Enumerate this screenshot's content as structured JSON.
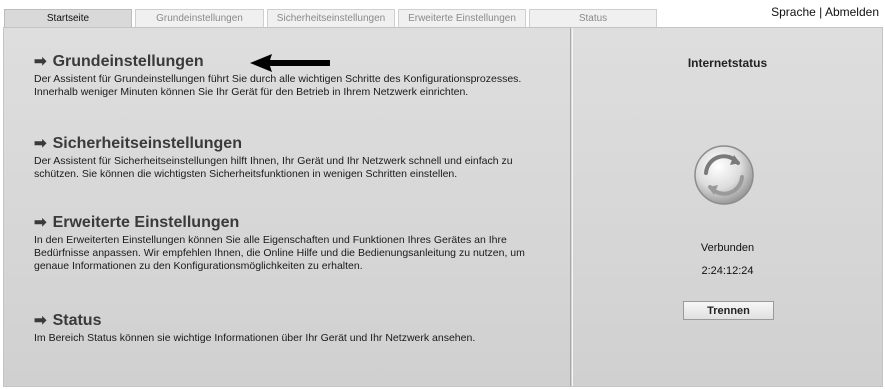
{
  "tabs": [
    {
      "label": "Startseite",
      "active": true
    },
    {
      "label": "Grundeinstellungen",
      "active": false
    },
    {
      "label": "Sicherheitseinstellungen",
      "active": false
    },
    {
      "label": "Erweiterte Einstellungen",
      "active": false
    },
    {
      "label": "Status",
      "active": false
    }
  ],
  "top_links": {
    "language": "Sprache",
    "separator": " | ",
    "logout": "Abmelden"
  },
  "sections": [
    {
      "title": "Grundeinstellungen",
      "description": "Der Assistent für Grundeinstellungen führt Sie durch alle wichtigen Schritte des Konfigurationsprozesses. Innerhalb weniger Minuten können Sie Ihr Gerät für den Betrieb in Ihrem Netzwerk einrichten."
    },
    {
      "title": "Sicherheitseinstellungen",
      "description": "Der Assistent für Sicherheitseinstellungen hilft Ihnen, Ihr Gerät und Ihr Netzwerk schnell und einfach zu schützen. Sie können die wichtigsten Sicherheitsfunktionen in wenigen Schritten einstellen."
    },
    {
      "title": "Erweiterte Einstellungen",
      "description": "In den Erweiterten Einstellungen können Sie alle Eigenschaften und Funktionen Ihres Gerätes an Ihre Bedürfnisse anpassen. Wir empfehlen Ihnen, die Online Hilfe und die Bedienungsanleitung zu nutzen, um genaue Informationen zu den Konfigurationsmöglichkeiten zu erhalten."
    },
    {
      "title": "Status",
      "description": "Im Bereich Status können sie wichtige Informationen über Ihr Gerät und Ihr Netzwerk ansehen."
    }
  ],
  "internet_status": {
    "title": "Internetstatus",
    "state": "Verbunden",
    "duration": "2:24:12:24",
    "button_label": "Trennen"
  },
  "icons": {
    "section_arrow": "right-arrow-icon",
    "pointer": "left-arrow-pointer-icon",
    "status": "globe-connection-icon"
  }
}
